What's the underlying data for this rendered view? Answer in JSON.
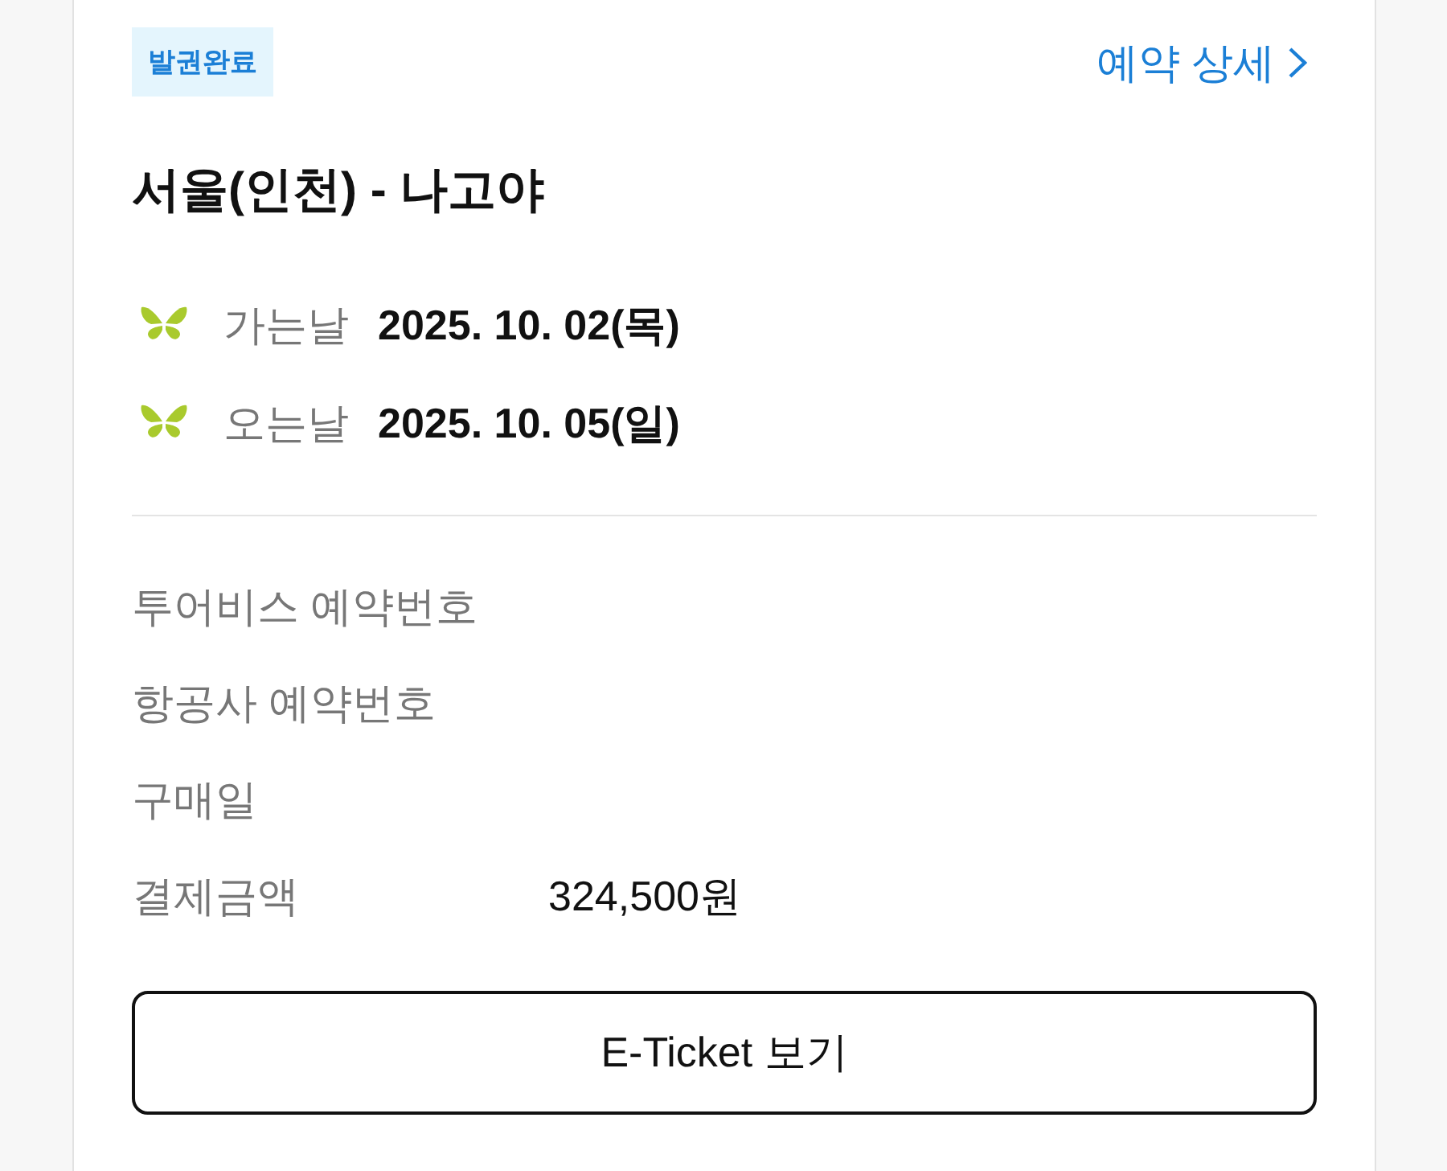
{
  "status_badge": "발권완료",
  "detail_link": {
    "label": "예약 상세"
  },
  "route_title": "서울(인천) - 나고야",
  "schedule": [
    {
      "label": "가는날",
      "date": "2025. 10. 02(목)"
    },
    {
      "label": "오는날",
      "date": "2025. 10. 05(일)"
    }
  ],
  "details": [
    {
      "label": "투어비스 예약번호"
    },
    {
      "label": "항공사 예약번호"
    },
    {
      "label": "구매일"
    },
    {
      "label": "결제금액",
      "value": "324,500원"
    }
  ],
  "eticket_button": {
    "label": "E-Ticket 보기"
  }
}
